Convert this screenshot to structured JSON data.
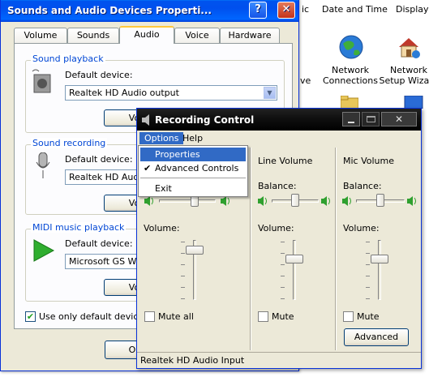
{
  "desktop": {
    "top_items": [
      "ic",
      "Date and Time",
      "Display"
    ],
    "icons": [
      {
        "label": "Network Connections",
        "icon": "network-globe-icon"
      },
      {
        "label": "Network Setup Wizard",
        "icon": "network-house-icon"
      }
    ],
    "fragments": [
      "ve",
      "D"
    ]
  },
  "sound_window": {
    "title": "Sounds and Audio Devices Properti...",
    "tabs": [
      "Volume",
      "Sounds",
      "Audio",
      "Voice",
      "Hardware"
    ],
    "selected_tab": "Audio",
    "playback": {
      "legend": "Sound playback",
      "label": "Default device:",
      "value": "Realtek HD Audio output",
      "button": "Vo"
    },
    "recording": {
      "legend": "Sound recording",
      "label": "Default device:",
      "value": "Realtek HD Audio",
      "button": "Vo"
    },
    "midi": {
      "legend": "MIDI music playback",
      "label": "Default device:",
      "value": "Microsoft GS Wav",
      "button": "Vo"
    },
    "use_only_default": {
      "label": "Use only default devices",
      "checked": true
    },
    "ok_button": "OK"
  },
  "recording_control": {
    "title": "Recording Control",
    "menu": [
      "Options",
      "Help"
    ],
    "dropdown": {
      "items": [
        {
          "label": "Properties",
          "highlighted": true,
          "checked": false
        },
        {
          "label": "Advanced Controls",
          "highlighted": false,
          "checked": true
        },
        {
          "label": "Exit",
          "highlighted": false,
          "checked": false
        }
      ]
    },
    "columns": [
      {
        "name": "",
        "balance_label": "",
        "volume_label": "Volume:",
        "mute_label": "Mute all",
        "volume_level": 0.85,
        "balance": 0.5
      },
      {
        "name": "Line Volume",
        "balance_label": "Balance:",
        "volume_label": "Volume:",
        "mute_label": "Mute",
        "volume_level": 0.6,
        "balance": 0.5
      },
      {
        "name": "Mic Volume",
        "balance_label": "Balance:",
        "volume_label": "Volume:",
        "mute_label": "Mute",
        "volume_level": 0.6,
        "balance": 0.5
      }
    ],
    "advanced_button": "Advanced",
    "status": "Realtek HD Audio Input"
  },
  "colors": {
    "xp_title_blue": "#0053ee",
    "legend_blue": "#0046d5",
    "menu_highlight": "#316ac5"
  }
}
